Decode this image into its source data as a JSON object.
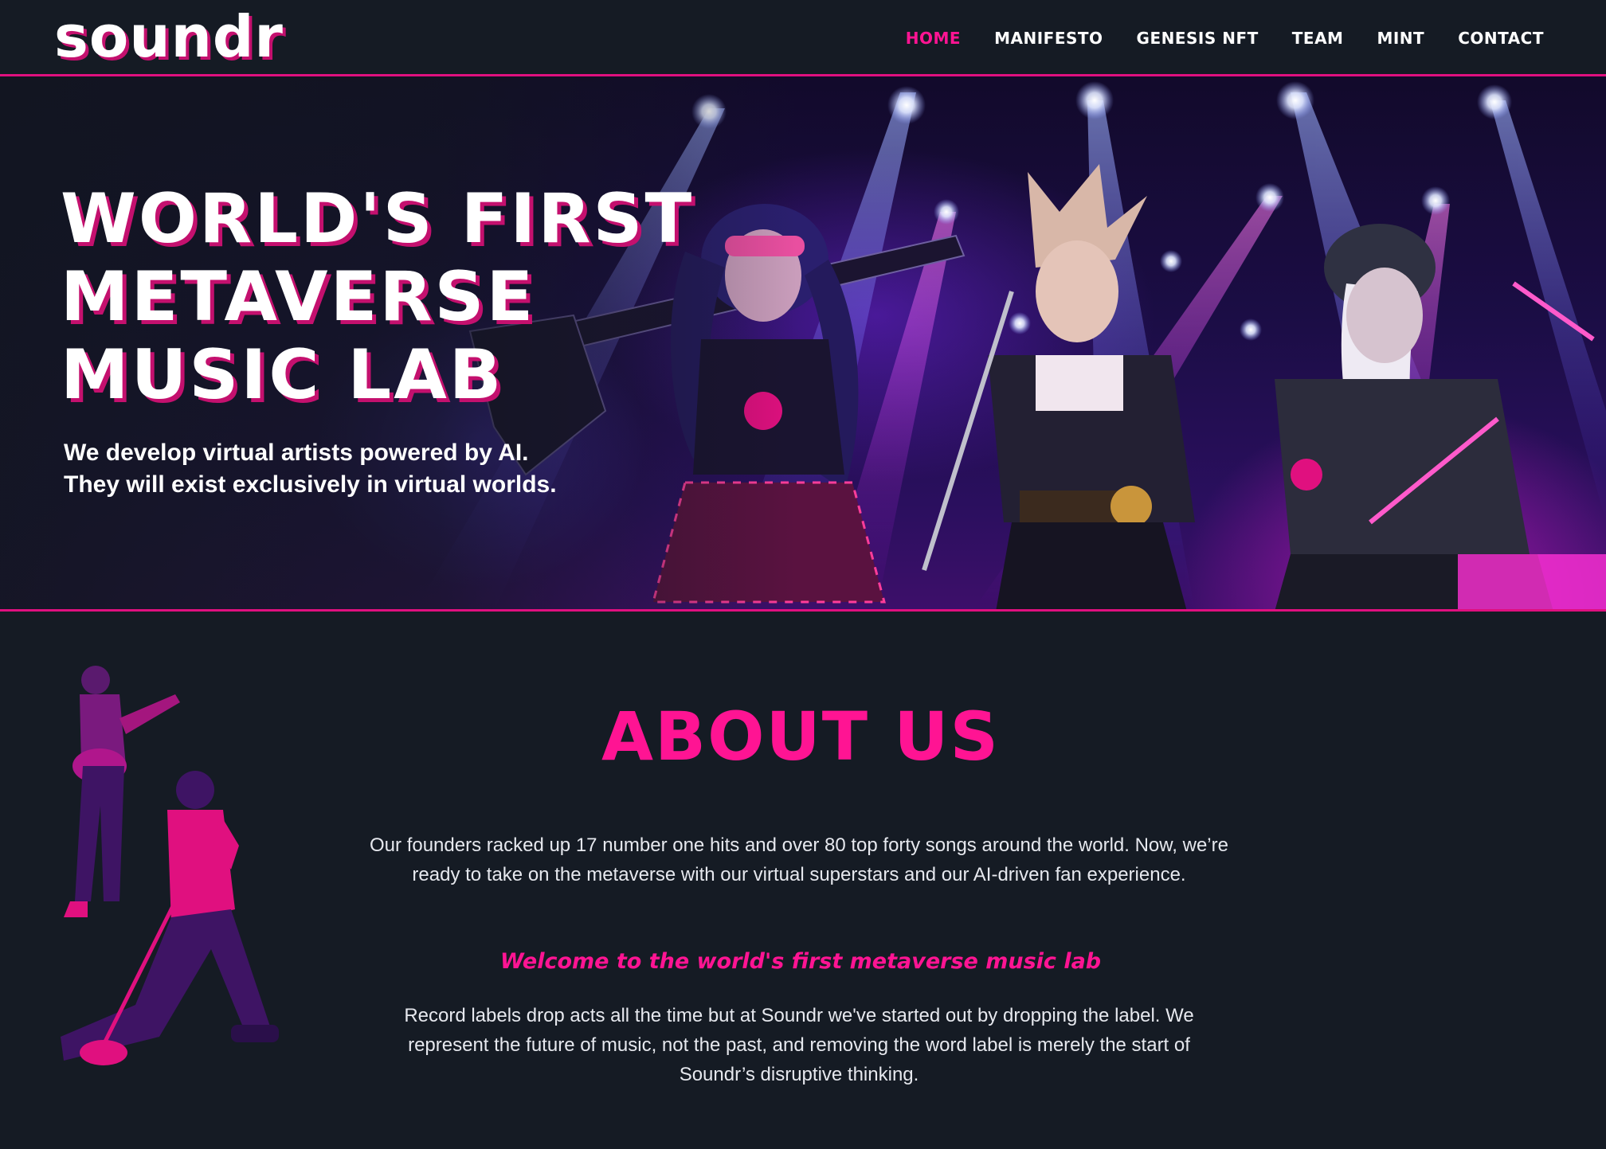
{
  "brand": {
    "logo": "soundr"
  },
  "nav": {
    "items": [
      {
        "label": "HOME",
        "active": true
      },
      {
        "label": "MANIFESTO",
        "active": false
      },
      {
        "label": "GENESIS NFT",
        "active": false
      },
      {
        "label": "TEAM",
        "active": false
      },
      {
        "label": "MINT",
        "active": false
      },
      {
        "label": "CONTACT",
        "active": false
      }
    ]
  },
  "hero": {
    "title_lines": [
      "WORLD'S FIRST",
      "METAVERSE",
      "MUSIC LAB"
    ],
    "subtitle_lines": [
      "We develop virtual artists powered by AI.",
      "They will exist exclusively in virtual worlds."
    ]
  },
  "about": {
    "title": "ABOUT US",
    "paragraph_1": "Our founders racked up 17 number one hits and over 80 top forty songs around the world. Now, we’re ready to take on the metaverse with our virtual superstars and our AI-driven fan experience.",
    "tagline": "Welcome to the world's first metaverse music lab",
    "paragraph_2": "Record labels drop acts all the time but at Soundr we've started out by dropping the label. We represent the future of music, not the past, and removing the word label is merely the start of Soundr’s disruptive thinking."
  },
  "colors": {
    "background": "#151b24",
    "accent": "#ff1493",
    "accent_dark": "#c4106e",
    "text": "#ffffff"
  }
}
